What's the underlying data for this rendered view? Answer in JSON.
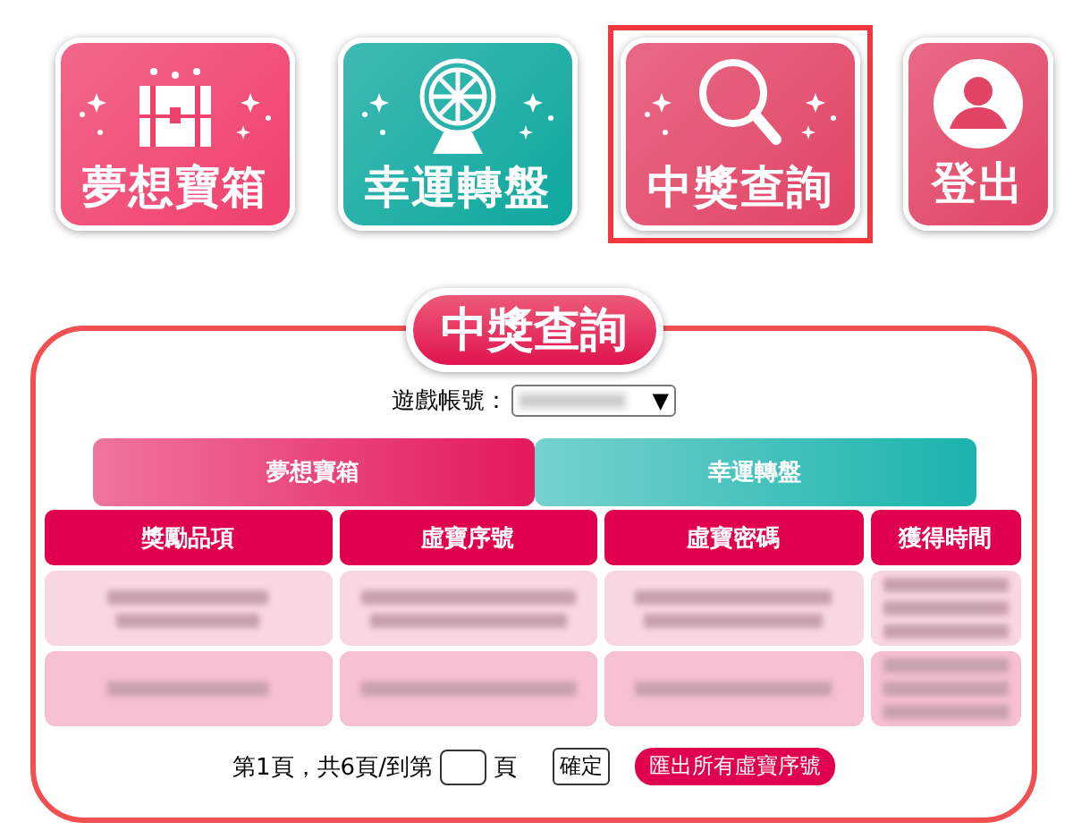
{
  "menu": [
    {
      "kind": "chest",
      "label": "夢想寶箱",
      "color": "#f0406e",
      "selected": false
    },
    {
      "kind": "wheel",
      "label": "幸運轉盤",
      "color": "#0ea89f",
      "selected": false
    },
    {
      "kind": "search",
      "label": "中獎查詢",
      "color": "#e24466",
      "selected": true
    },
    {
      "kind": "user",
      "label": "登出",
      "color": "#e24466",
      "selected": false
    }
  ],
  "section": {
    "title": "中獎查詢",
    "account_label": "遊戲帳號：",
    "account_select": {
      "arrow": "▼"
    },
    "tabs": [
      {
        "label": "夢想寶箱",
        "color": "#e4195a"
      },
      {
        "label": "幸運轉盤",
        "color": "#1ab3ad"
      }
    ],
    "table": {
      "columns": [
        "獎勵品項",
        "虛寶序號",
        "虛寶密碼",
        "獲得時間"
      ],
      "rows": [
        {
          "color": "#f9d7e2"
        },
        {
          "color": "#f6bfd2"
        }
      ]
    },
    "pager": {
      "text_before": "第1頁，共6頁/到第",
      "text_after": "頁",
      "confirm": "確定",
      "export": "匯出所有虛寶序號"
    }
  }
}
